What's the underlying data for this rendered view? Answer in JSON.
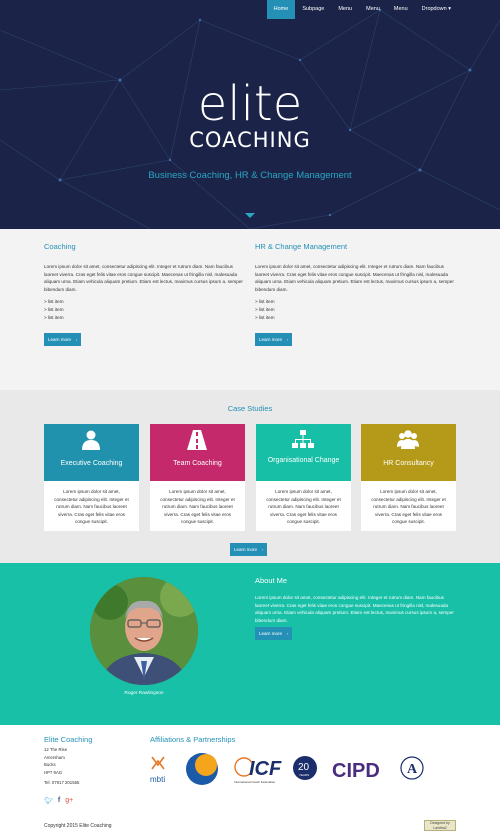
{
  "nav": {
    "items": [
      "Home",
      "Subpage",
      "Menu",
      "Menu",
      "Menu",
      "Dropdown ▾"
    ]
  },
  "hero": {
    "logo_top": "elite",
    "logo_bottom": "COACHING",
    "tagline": "Business Coaching, HR & Change Management"
  },
  "services": [
    {
      "title": "Coaching",
      "text": "Lorem ipsum dolor sit amet, consectetur adipiscing elit. Integer et rutrum diam. Nam faucibus laoreet viverra. Cras eget felis vitae eros congue suscipit. Maecenas ut fringilla nisl, malesuada aliquam urna. Etiam vehicula aliquam pretium. Etiam est lectus, maximus cursus ipsum a, semper bibendum diam.",
      "list": [
        "> list item",
        "> list item",
        "> list item"
      ],
      "button": "Learn more"
    },
    {
      "title": "HR & Change Management",
      "text": "Lorem ipsum dolor sit amet, consectetur adipiscing elit. Integer et rutrum diam. Nam faucibus laoreet viverra. Cras eget felis vitae eros congue suscipit. Maecenas ut fringilla nisl, malesuada aliquam urna. Etiam vehicula aliquam pretium. Etiam est lectus, maximus cursus ipsum a, semper bibendum diam.",
      "list": [
        "> list item",
        "> list item",
        "> list item"
      ],
      "button": "Learn more"
    }
  ],
  "cases": {
    "title": "Case Studies",
    "button": "Learn more",
    "cards": [
      {
        "title": "Executive Coaching",
        "color": "#2192ad",
        "icon": "person-icon",
        "text": "Lorem ipsum dolor sit amet, consectetur adipiscing elit. Integer et rutrum diam. Nam faucibus laoreet viverra. Cras eget felis vitae eros congue suscipit."
      },
      {
        "title": "Team Coaching",
        "color": "#c42a6b",
        "icon": "road-icon",
        "text": "Lorem ipsum dolor sit amet, consectetur adipiscing elit. Integer et rutrum diam. Nam faucibus laoreet viverra. Cras eget felis vitae eros congue suscipit."
      },
      {
        "title": "Organisational Change",
        "color": "#17bfa6",
        "icon": "org-chart-icon",
        "text": "Lorem ipsum dolor sit amet, consectetur adipiscing elit. Integer et rutrum diam. Nam faucibus laoreet viverra. Cras eget felis vitae eros congue suscipit."
      },
      {
        "title": "HR Consultancy",
        "color": "#b59a1a",
        "icon": "group-icon",
        "text": "Lorem ipsum dolor sit amet, consectetur adipiscing elit. Integer et rutrum diam. Nam faucibus laoreet viverra. Cras eget felis vitae eros congue suscipit."
      }
    ]
  },
  "about": {
    "title": "About Me",
    "text": "Lorem ipsum dolor sit amet, consectetur adipiscing elit. Integer et rutrum diam. Nam faucibus laoreet viverra. Cras eget felis vitae eros congue suscipit. Maecenas ut fringilla nisl, malesuada aliquam urna. Etiam vehicula aliquam pretium. Etiam est lectus, maximus cursus ipsum a, semper bibendum diam.",
    "button": "Learn more",
    "photo_name": "Roger Rawlingson"
  },
  "footer": {
    "title": "Elite Coaching",
    "address": [
      "12 The Rise",
      "Amersham",
      "Bucks",
      "HP7 9AG"
    ],
    "tel": "Tel: 07917 201555",
    "social": [
      "twitter-icon",
      "facebook-icon",
      "google-plus-icon"
    ],
    "affiliations_title": "Affiliations & Partnerships",
    "logos": {
      "mbti": "mbti",
      "icf": "ICF",
      "icf_sub": "International Coach Federation",
      "icf_years": "20",
      "icf_years_label": "YEARS",
      "cipd": "CIPD",
      "circle_text": "A"
    },
    "copyright": "Copyright 2015 Elite Coaching",
    "badge": "Designed by Lamtha2"
  },
  "colors": {
    "hero_bg": "#1b2448",
    "accent": "#2590b6",
    "about_bg": "#18c0a7"
  }
}
